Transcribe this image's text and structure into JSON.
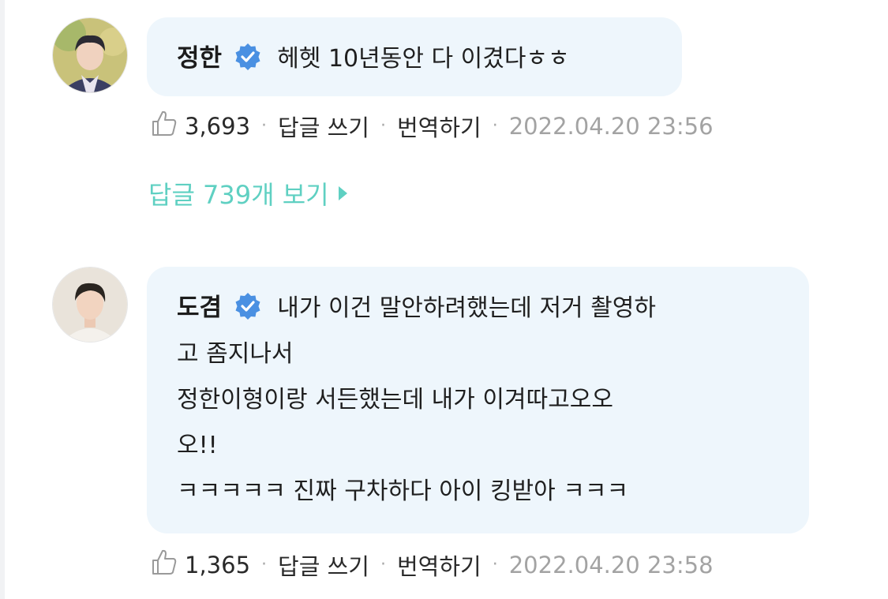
{
  "comments": [
    {
      "author": "정한",
      "verified_icon": "verified-badge-icon",
      "text_lines": [
        "헤헷 10년동안 다 이겼다ㅎㅎ"
      ],
      "likes": "3,693",
      "reply_label": "답글 쓰기",
      "translate_label": "번역하기",
      "timestamp": "2022.04.20 23:56",
      "view_replies": "답글 739개 보기"
    },
    {
      "author": "도겸",
      "verified_icon": "verified-badge-icon",
      "text_lines": [
        "내가 이건 말안하려했는데 저거 촬영하",
        "고 좀지나서",
        "정한이형이랑 서든했는데 내가 이겨따고오오",
        "오!!",
        "ㅋㅋㅋㅋㅋ 진짜 구차하다 아이 킹받아 ㅋㅋㅋ"
      ],
      "likes": "1,365",
      "reply_label": "답글 쓰기",
      "translate_label": "번역하기",
      "timestamp": "2022.04.20 23:58"
    }
  ],
  "colors": {
    "bubble": "#eef6fc",
    "accent": "#5fd0c2",
    "verified": "#4a90e2",
    "meta_gray": "#a3a3a3"
  },
  "icons": [
    "avatar",
    "verified-badge-icon",
    "thumbs-up-icon",
    "play-triangle-icon"
  ]
}
